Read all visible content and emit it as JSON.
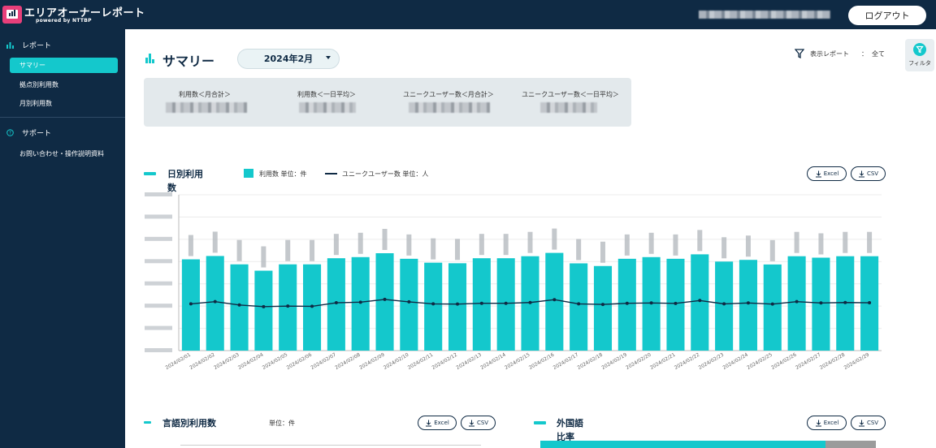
{
  "app": {
    "title": "エリアオーナーレポート",
    "subtitle": "powered by NTTBP",
    "logout_label": "ログアウト"
  },
  "sidebar": {
    "report_section": "レポート",
    "items": [
      "サマリー",
      "拠点別利用数",
      "月別利用数"
    ],
    "active_item": "サマリー",
    "support_section": "サポート",
    "support_items": [
      "お問い合わせ・操作説明資料"
    ]
  },
  "summary": {
    "title": "サマリー",
    "month": "2024年2月",
    "report_label": "表示レポート",
    "report_colon": "：",
    "report_value": "全て",
    "filter_label": "フィルタ",
    "metrics": [
      {
        "label": "利用数＜月合計＞"
      },
      {
        "label": "利用数＜一日平均＞"
      },
      {
        "label": "ユニークユーザー数＜月合計＞"
      },
      {
        "label": "ユニークユーザー数＜一日平均＞"
      }
    ]
  },
  "daily": {
    "title": "日別利用数",
    "legend_bar": "利用数 単位：件",
    "legend_line": "ユニークユーザー数 単位：人",
    "excel_label": "Excel",
    "csv_label": "CSV"
  },
  "chart_data": {
    "type": "bar",
    "categories": [
      "2024/02/01",
      "2024/02/02",
      "2024/02/03",
      "2024/02/04",
      "2024/02/05",
      "2024/02/06",
      "2024/02/07",
      "2024/02/08",
      "2024/02/09",
      "2024/02/10",
      "2024/02/11",
      "2024/02/12",
      "2024/02/13",
      "2024/02/14",
      "2024/02/15",
      "2024/02/16",
      "2024/02/17",
      "2024/02/18",
      "2024/02/19",
      "2024/02/20",
      "2024/02/21",
      "2024/02/22",
      "2024/02/23",
      "2024/02/24",
      "2024/02/25",
      "2024/02/26",
      "2024/02/27",
      "2024/02/28",
      "2024/02/29"
    ],
    "series": [
      {
        "name": "利用数 単位：件",
        "kind": "bar",
        "color": "#14c8cc",
        "values": [
          820,
          850,
          775,
          718,
          775,
          775,
          830,
          840,
          875,
          825,
          790,
          785,
          830,
          830,
          848,
          878,
          784,
          760,
          825,
          840,
          825,
          865,
          800,
          815,
          774,
          848,
          835,
          848,
          848
        ]
      },
      {
        "name": "ユニークユーザー数 単位：人",
        "kind": "line",
        "color": "#0f2a44",
        "values": [
          420,
          440,
          410,
          395,
          400,
          398,
          430,
          435,
          460,
          438,
          420,
          418,
          425,
          425,
          432,
          458,
          420,
          415,
          425,
          428,
          424,
          450,
          420,
          428,
          418,
          440,
          428,
          432,
          430
        ]
      }
    ],
    "ylim": [
      0,
      1400
    ],
    "grid": true
  },
  "language": {
    "title": "言語別利用数",
    "unit": "単位：件",
    "excel_label": "Excel",
    "csv_label": "CSV"
  },
  "foreign": {
    "title": "外国語比率",
    "excel_label": "Excel",
    "csv_label": "CSV",
    "ratio": 0.85
  },
  "colors": {
    "accent": "#14c8cc",
    "navy": "#0f2a44",
    "card": "#e3e9ec"
  }
}
